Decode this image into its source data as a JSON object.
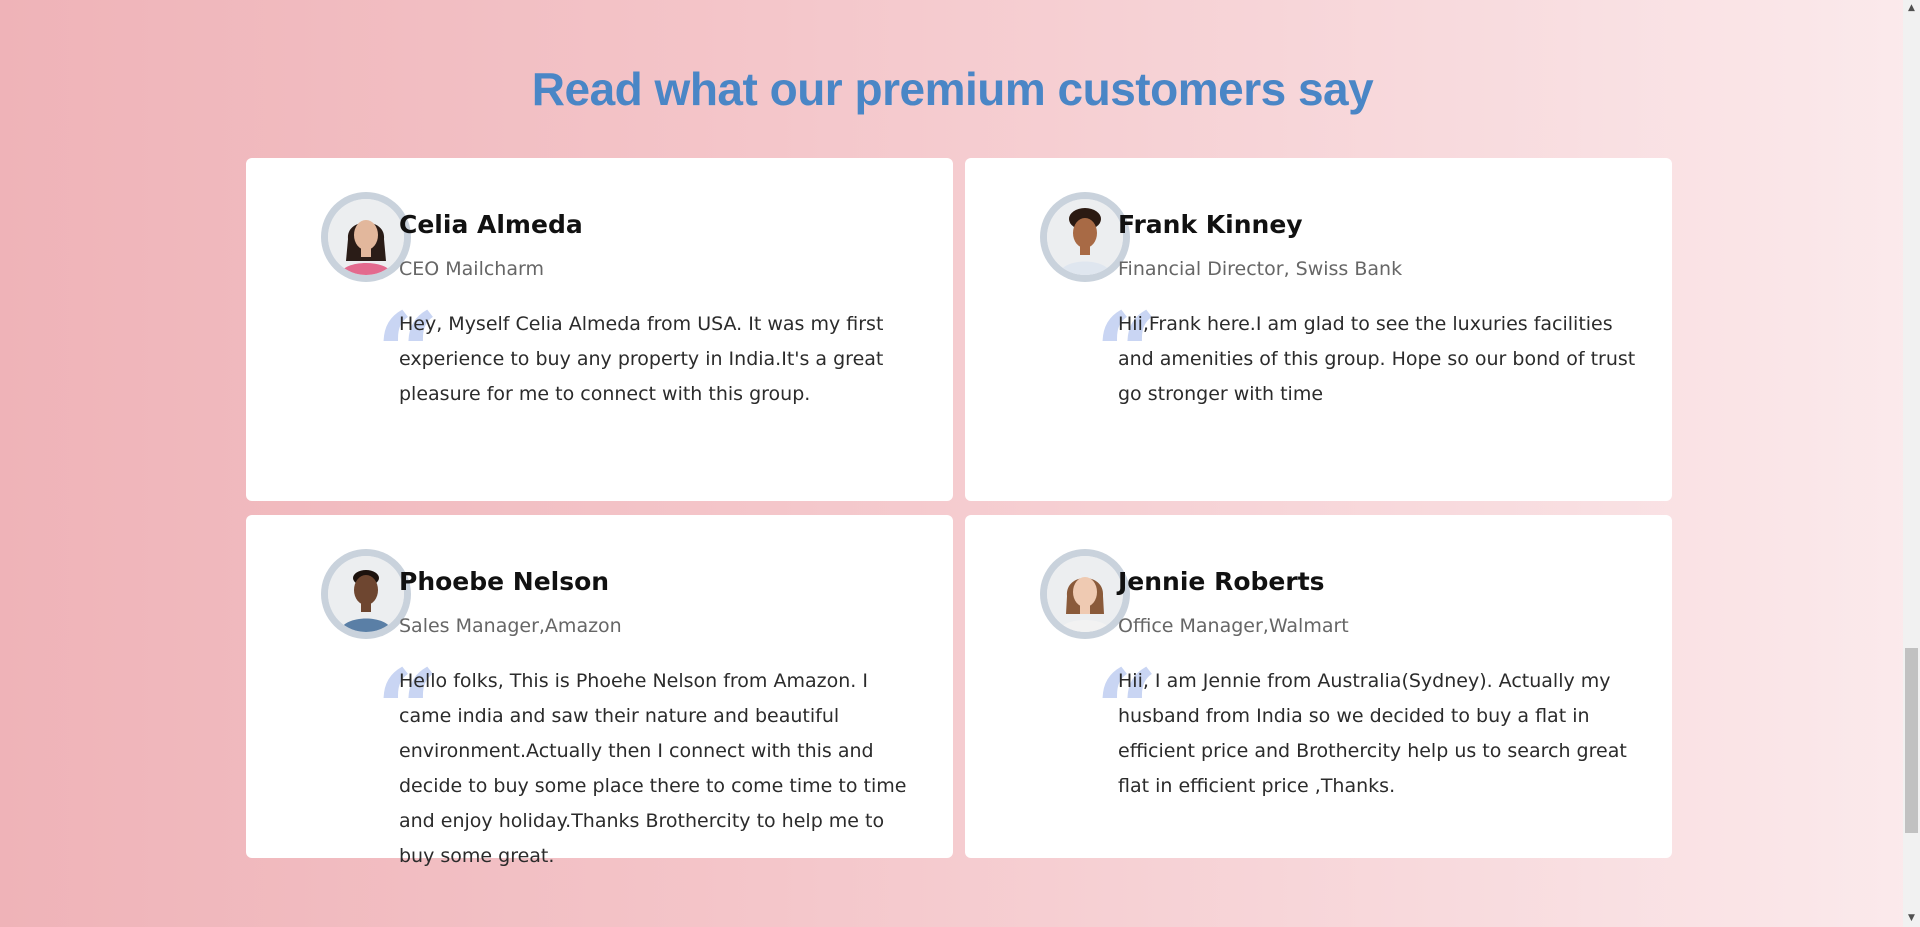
{
  "section": {
    "heading": "Read what our premium customers say",
    "heading_color": "#4a86c6",
    "quote_glyph": "“",
    "quote_color": "#c9d5f3"
  },
  "testimonials": [
    {
      "name": "Celia Almeda",
      "role": "CEO Mailcharm",
      "text": "Hey, Myself Celia Almeda from USA. It was my first experience to buy any property in India.It's a great pleasure for me to connect with this group.",
      "avatar": "woman-portrait-avatar"
    },
    {
      "name": "Frank Kinney",
      "role": "Financial Director, Swiss Bank",
      "text": "Hii,Frank here.I am glad to see the luxuries facilities and amenities of this group. Hope so our bond of trust go stronger with time",
      "avatar": "man-portrait-avatar"
    },
    {
      "name": "Phoebe Nelson",
      "role": "Sales Manager,Amazon",
      "text": "Hello folks, This is Phoehe Nelson from Amazon. I came india and saw their nature and beautiful environment.Actually then I connect with this and decide to buy some place there to come time to time and enjoy holiday.Thanks Brothercity to help me to buy some great.",
      "avatar": "man-portrait-avatar"
    },
    {
      "name": "Jennie Roberts",
      "role": "Office Manager,Walmart",
      "text": "Hii, I am Jennie from Australia(Sydney). Actually my husband from India so we decided to buy a flat in efficient price and Brothercity help us to search great flat in efficient price ,Thanks.",
      "avatar": "woman-portrait-avatar"
    }
  ],
  "scrollbar": {
    "up_glyph": "▲",
    "down_glyph": "▼"
  }
}
